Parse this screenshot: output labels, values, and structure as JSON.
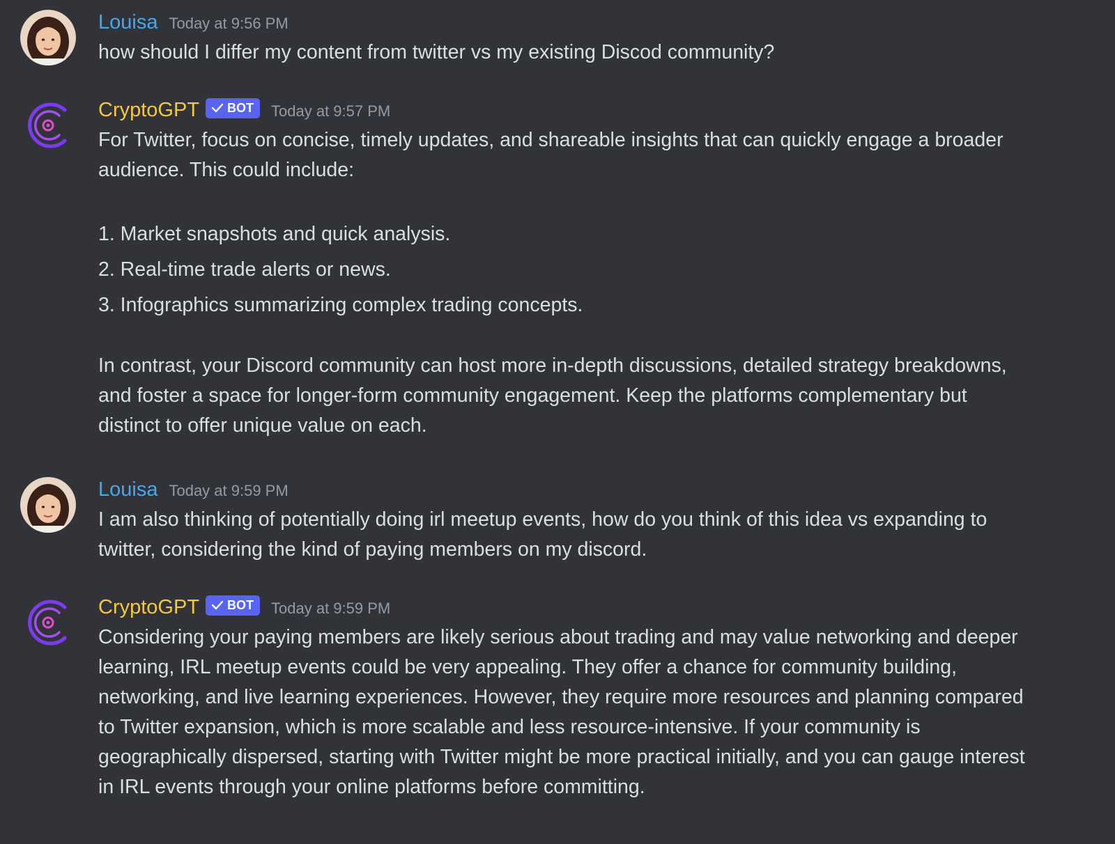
{
  "messages": [
    {
      "author": "Louisa",
      "timestamp": "Today at 9:56 PM",
      "text": "how should I differ my content from twitter vs my existing Discod community?"
    },
    {
      "author": "CryptoGPT",
      "badge": "BOT",
      "timestamp": "Today at 9:57 PM",
      "intro": "For Twitter, focus on concise, timely updates, and shareable insights that can quickly engage a broader audience. This could include:",
      "list": [
        "1. Market snapshots and quick analysis.",
        "2. Real-time trade alerts or news.",
        "3. Infographics summarizing complex trading concepts."
      ],
      "outro": "In contrast, your Discord community can host more in-depth discussions, detailed strategy breakdowns, and foster a space for longer-form community engagement. Keep the platforms complementary but distinct to offer unique value on each."
    },
    {
      "author": "Louisa",
      "timestamp": "Today at 9:59 PM",
      "text": "I am also thinking of potentially doing irl meetup events, how do you think of this idea vs expanding to twitter, considering the kind of paying members on my discord."
    },
    {
      "author": "CryptoGPT",
      "badge": "BOT",
      "timestamp": "Today at 9:59 PM",
      "text": "Considering your paying members are likely serious about trading and may value networking and deeper learning, IRL meetup events could be very appealing. They offer a chance for community building, networking, and live learning experiences. However, they require more resources and planning compared to Twitter expansion, which is more scalable and less resource-intensive. If your community is geographically dispersed, starting with Twitter might be more practical initially, and you can gauge interest in IRL events through your online platforms before committing."
    }
  ],
  "colors": {
    "background": "#313338",
    "user_name": "#46a7ef",
    "bot_name": "#f5c842",
    "bot_badge": "#5865f2",
    "timestamp": "#949ba4",
    "text": "#dbdee1"
  },
  "icons": {
    "user_avatar": "user-avatar-photo",
    "bot_avatar": "cryptogpt-logo-icon",
    "verified": "checkmark-icon"
  }
}
